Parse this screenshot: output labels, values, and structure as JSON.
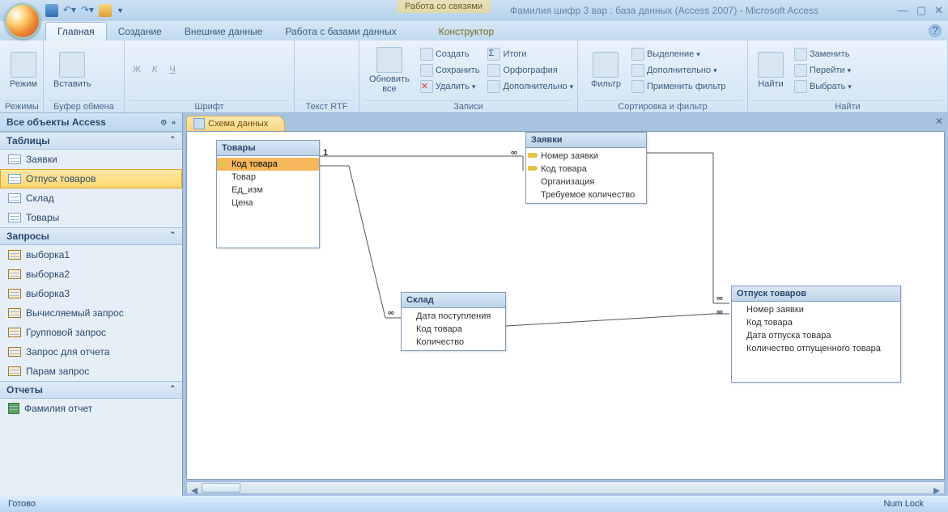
{
  "title_context": "Работа со связями",
  "title_text": "Фамилия шифр 3 вар : база данных (Access 2007) - Microsoft Access",
  "tabs": {
    "main": "Главная",
    "create": "Создание",
    "external": "Внешние данные",
    "dbwork": "Работа с базами данных",
    "ctx": "Конструктор"
  },
  "ribbon": {
    "views": {
      "label": "Режимы",
      "btn": "Режим"
    },
    "clipboard": {
      "label": "Буфер обмена",
      "btn": "Вставить"
    },
    "font": {
      "label": "Шрифт"
    },
    "rtf": {
      "label": "Текст RTF"
    },
    "records": {
      "label": "Записи",
      "refresh": "Обновить все",
      "new": "Создать",
      "save": "Сохранить",
      "delete": "Удалить",
      "totals": "Итоги",
      "spell": "Орфография",
      "more": "Дополнительно"
    },
    "sortfilter": {
      "label": "Сортировка и фильтр",
      "filter": "Фильтр",
      "selection": "Выделение",
      "advanced": "Дополнительно",
      "toggle": "Применить фильтр"
    },
    "find": {
      "label": "Найти",
      "find": "Найти",
      "replace": "Заменить",
      "goto": "Перейти",
      "select": "Выбрать"
    }
  },
  "nav": {
    "header": "Все объекты Access",
    "groups": {
      "tables": "Таблицы",
      "queries": "Запросы",
      "reports": "Отчеты"
    },
    "tables": [
      "Заявки",
      "Отпуск товаров",
      "Склад",
      "Товары"
    ],
    "queries": [
      "выборка1",
      "выборка2",
      "выборка3",
      "Вычисляемый запрос",
      "Групповой запрос",
      "Запрос для отчета",
      "Парам запрос"
    ],
    "reports": [
      "Фамилия отчет"
    ]
  },
  "workspace_tab": "Схема данных",
  "tablesDiagram": {
    "t1": {
      "title": "Товары",
      "fields": [
        "Код товара",
        "Товар",
        "Ед_изм",
        "Цена"
      ],
      "keys": [
        0
      ]
    },
    "t2": {
      "title": "Заявки",
      "fields": [
        "Номер заявки",
        "Код товара",
        "Организация",
        "Требуемое количество"
      ],
      "keys": [
        0,
        1
      ]
    },
    "t3": {
      "title": "Склад",
      "fields": [
        "Дата поступления",
        "Код товара",
        "Количество"
      ],
      "keys": []
    },
    "t4": {
      "title": "Отпуск товаров",
      "fields": [
        "Номер заявки",
        "Код товара",
        "Дата отпуска товара",
        "Количество отпущенного товара"
      ],
      "keys": []
    }
  },
  "rel_labels": {
    "one": "1",
    "many": "∞"
  },
  "status": {
    "left": "Готово",
    "right": "Num Lock"
  }
}
